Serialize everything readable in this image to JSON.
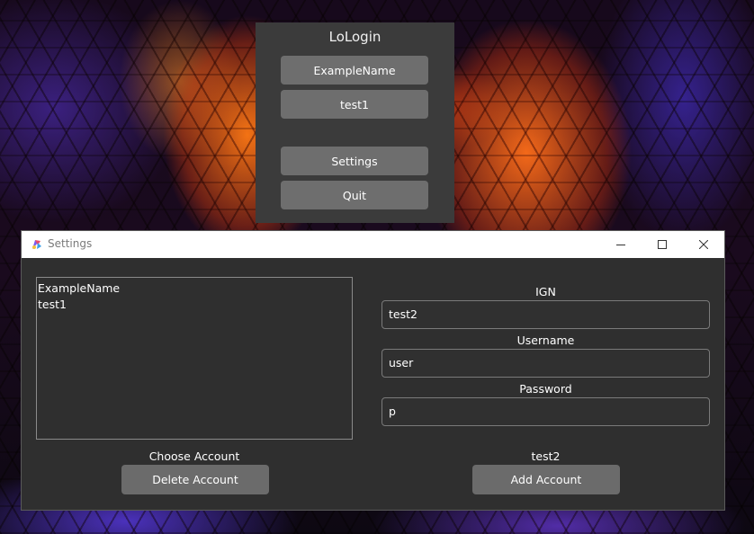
{
  "lologin": {
    "title": "LoLogin",
    "accounts": [
      "ExampleName",
      "test1"
    ],
    "settings_label": "Settings",
    "quit_label": "Quit"
  },
  "settings_window": {
    "title": "Settings",
    "account_list": [
      "ExampleName",
      "test1"
    ],
    "choose_account_label": "Choose Account",
    "delete_button": "Delete Account",
    "ign_label": "IGN",
    "ign_value": "test2",
    "username_label": "Username",
    "username_value": "user",
    "password_label": "Password",
    "password_value": "p",
    "status_text": "test2",
    "add_button": "Add Account"
  }
}
